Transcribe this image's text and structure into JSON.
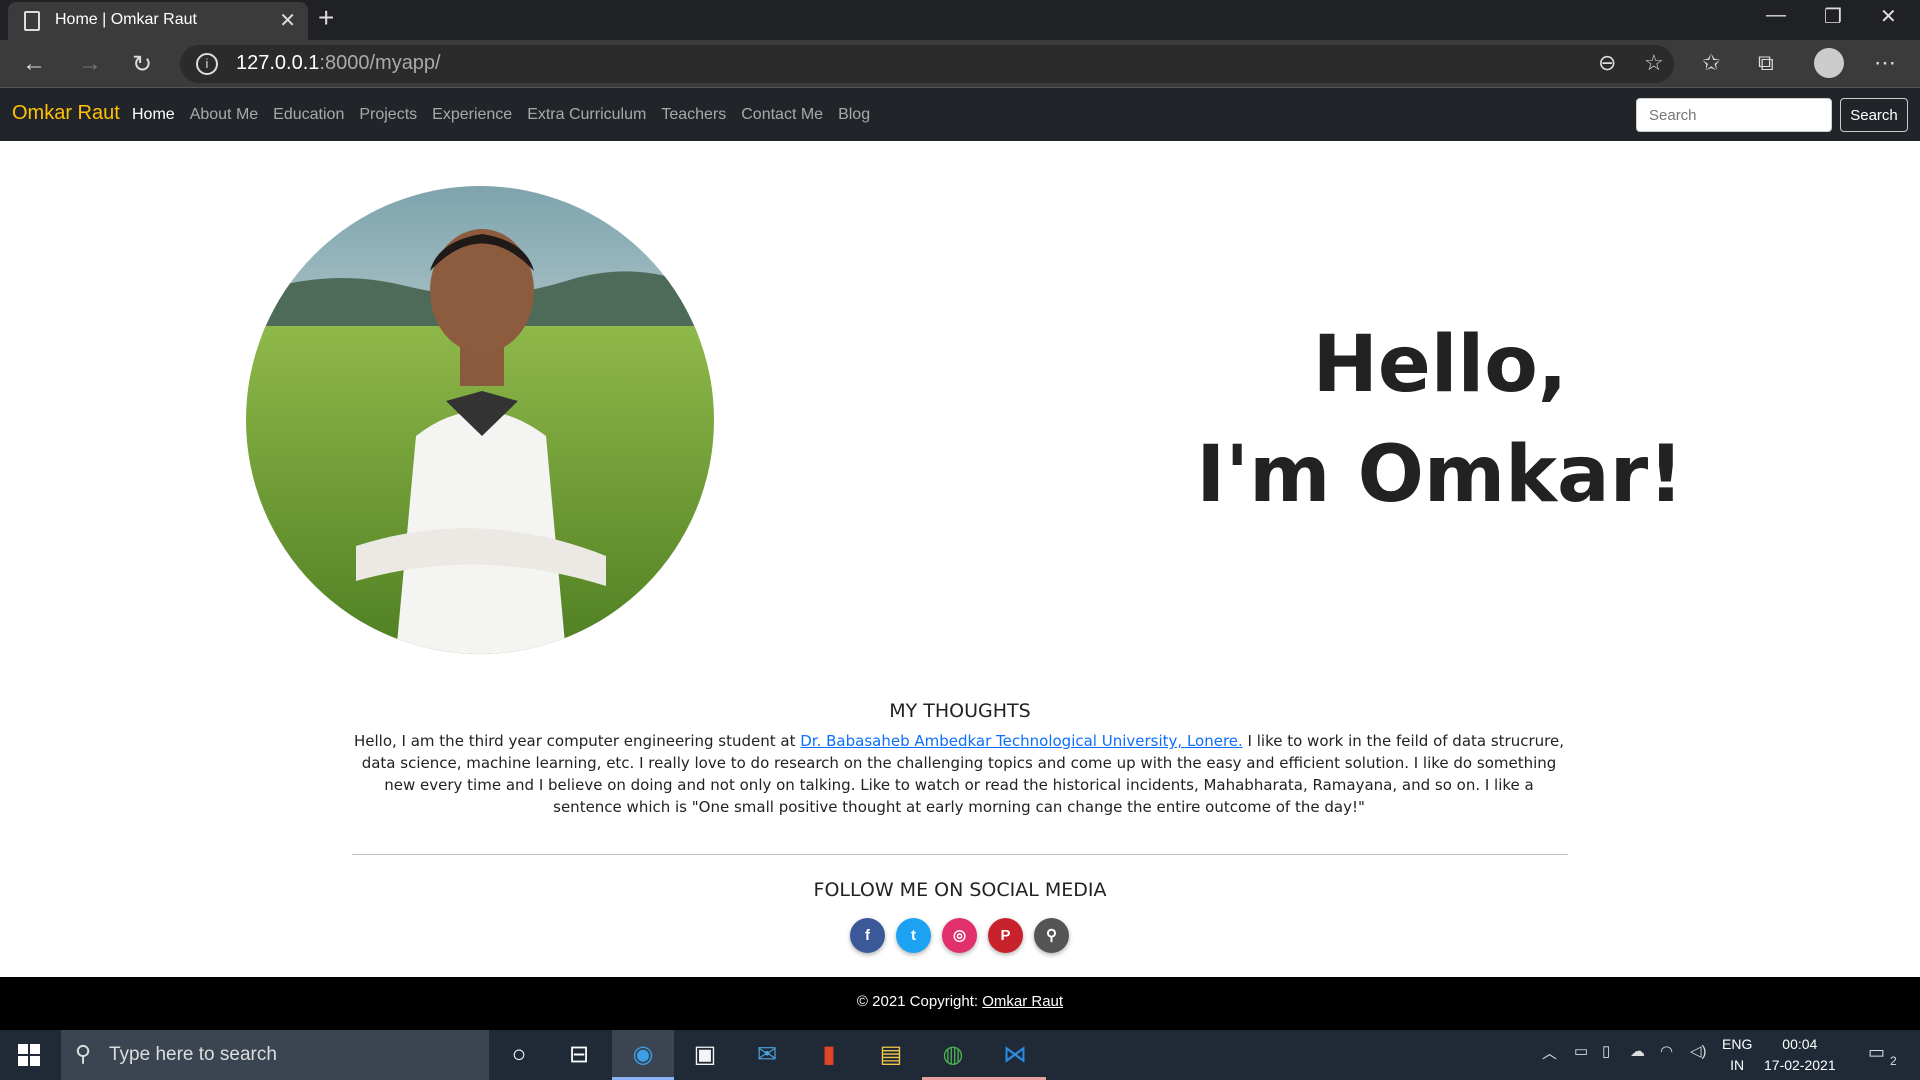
{
  "browser": {
    "tab_title": "Home | Omkar Raut",
    "url_host": "127.0.0.1",
    "url_path": ":8000/myapp/"
  },
  "site": {
    "brand": "Omkar Raut",
    "nav": [
      "Home",
      "About Me",
      "Education",
      "Projects",
      "Experience",
      "Extra Curriculum",
      "Teachers",
      "Contact Me",
      "Blog"
    ],
    "search_placeholder": "Search",
    "search_button": "Search",
    "brand_color": "#ffc107",
    "navbar_color": "#212529"
  },
  "hero": {
    "line1": "Hello,",
    "line2": "I'm Omkar!"
  },
  "thoughts": {
    "title": "MY THOUGHTS",
    "text_before": "Hello, I am the third year computer engineering student at ",
    "link": "Dr. Babasaheb Ambedkar Technological University, Lonere.",
    "text_after": " I like to work in the feild of data strucrure, data science, machine learning, etc. I really love to do research on the challenging topics and come up with the easy and efficient solution. I like do something new every time and I believe on doing and not only on talking. Like to watch or read the historical incidents, Mahabharata, Ramayana, and so on. I like a sentence which is \"One small positive thought at early morning can change the entire outcome of the day!\""
  },
  "social": {
    "title": "FOLLOW ME ON SOCIAL MEDIA",
    "icons": [
      {
        "name": "facebook-icon",
        "glyph": "f",
        "color": "#3b5998"
      },
      {
        "name": "twitter-icon",
        "glyph": "t",
        "color": "#1da1f2"
      },
      {
        "name": "instagram-icon",
        "glyph": "◎",
        "color": "#e1306c"
      },
      {
        "name": "pinterest-icon",
        "glyph": "P",
        "color": "#c8232c"
      },
      {
        "name": "steam-icon",
        "glyph": "⚲",
        "color": "#555555"
      }
    ]
  },
  "footer": {
    "prefix": "© 2021 Copyright: ",
    "link": "Omkar Raut"
  },
  "taskbar": {
    "search_placeholder": "Type here to search",
    "lang_line1": "ENG",
    "lang_line2": "IN",
    "time": "00:04",
    "date": "17-02-2021",
    "notification_count": "2"
  }
}
